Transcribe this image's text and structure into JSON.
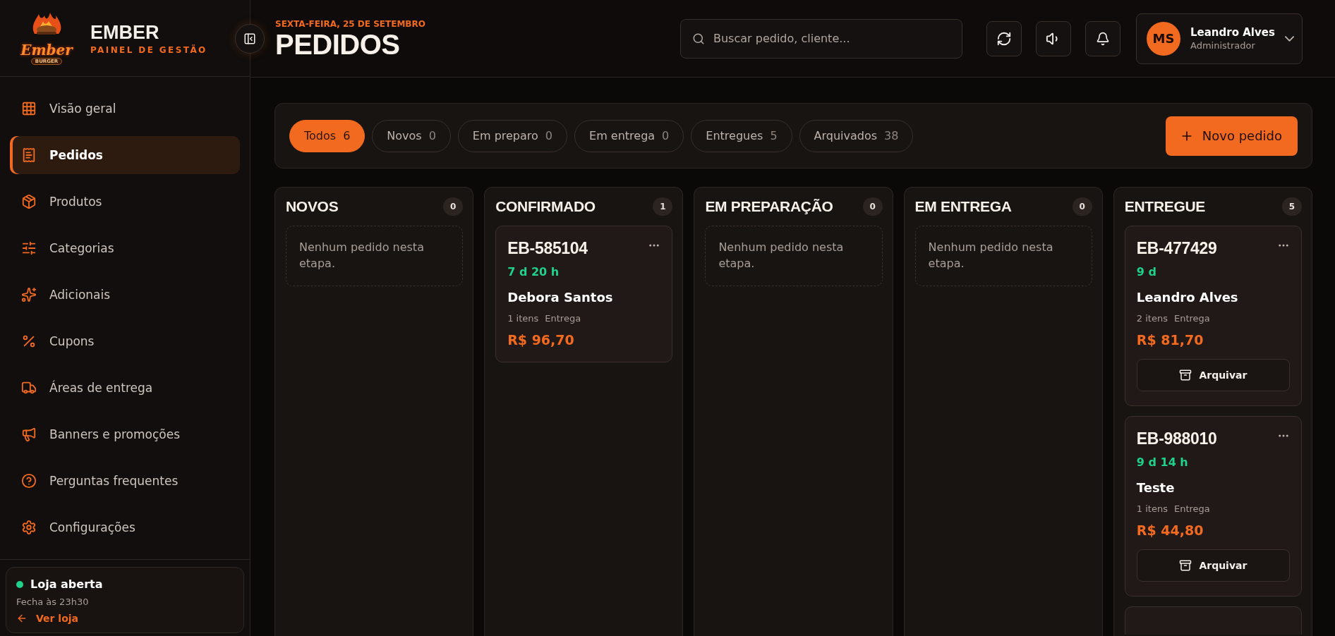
{
  "brand": {
    "logo_word": "Ember",
    "logo_sub": "BURGER",
    "name": "EMBER",
    "subtitle": "PAINEL DE GESTÃO"
  },
  "sidebar": {
    "items": [
      {
        "label": "Visão geral",
        "selected": false
      },
      {
        "label": "Pedidos",
        "selected": true
      },
      {
        "label": "Produtos",
        "selected": false
      },
      {
        "label": "Categorias",
        "selected": false
      },
      {
        "label": "Adicionais",
        "selected": false
      },
      {
        "label": "Cupons",
        "selected": false
      },
      {
        "label": "Áreas de entrega",
        "selected": false
      },
      {
        "label": "Banners e promoções",
        "selected": false
      },
      {
        "label": "Perguntas frequentes",
        "selected": false
      },
      {
        "label": "Configurações",
        "selected": false
      }
    ],
    "store": {
      "status": "Loja aberta",
      "open": true,
      "hours": "Fecha às 23h30",
      "link": "Ver loja"
    }
  },
  "header": {
    "date": "SEXTA-FEIRA, 25 DE SETEMBRO",
    "title": "PEDIDOS",
    "search": {
      "placeholder": "Buscar pedido, cliente..."
    },
    "user": {
      "initials": "MS",
      "name": "Leandro Alves",
      "role": "Administrador"
    }
  },
  "filters": [
    {
      "label": "Todos",
      "count": "6",
      "selected": true
    },
    {
      "label": "Novos",
      "count": "0",
      "selected": false
    },
    {
      "label": "Em preparo",
      "count": "0",
      "selected": false
    },
    {
      "label": "Em entrega",
      "count": "0",
      "selected": false
    },
    {
      "label": "Entregues",
      "count": "5",
      "selected": false
    },
    {
      "label": "Arquivados",
      "count": "38",
      "selected": false
    }
  ],
  "new_button": "Novo pedido",
  "columns": [
    {
      "title": "NOVOS",
      "count": "0",
      "empty": "Nenhum pedido nesta etapa."
    },
    {
      "title": "CONFIRMADO",
      "count": "1",
      "orders": [
        {
          "code": "EB-585104",
          "age": "7 d 20 h",
          "customer": "Debora Santos",
          "items": "1 itens",
          "mode": "Entrega",
          "total": "R$ 96,70"
        }
      ]
    },
    {
      "title": "EM PREPARAÇÃO",
      "count": "0",
      "empty": "Nenhum pedido nesta etapa."
    },
    {
      "title": "EM ENTREGA",
      "count": "0",
      "empty": "Nenhum pedido nesta etapa."
    },
    {
      "title": "ENTREGUE",
      "count": "5",
      "more_below": true,
      "orders": [
        {
          "code": "EB-477429",
          "age": "9 d",
          "customer": "Leandro Alves",
          "items": "2 itens",
          "mode": "Entrega",
          "total": "R$ 81,70",
          "archive": "Arquivar"
        },
        {
          "code": "EB-988010",
          "age": "9 d 14 h",
          "customer": "Teste",
          "items": "1 itens",
          "mode": "Entrega",
          "total": "R$ 44,80",
          "archive": "Arquivar"
        }
      ]
    }
  ]
}
